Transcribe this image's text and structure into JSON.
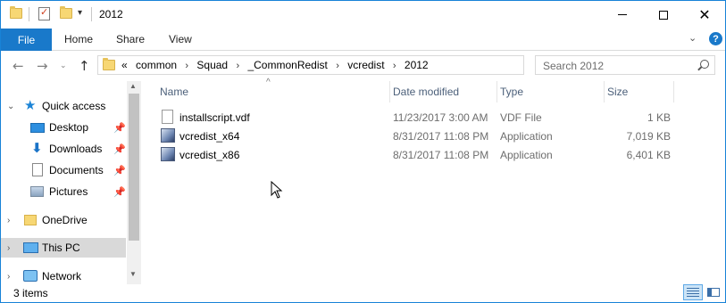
{
  "window": {
    "title": "2012"
  },
  "ribbon": {
    "tabs": [
      "File",
      "Home",
      "Share",
      "View"
    ]
  },
  "address": {
    "breadcrumbs": [
      "common",
      "Squad",
      "_CommonRedist",
      "vcredist",
      "2012"
    ],
    "overflow": "«"
  },
  "search": {
    "placeholder": "Search 2012"
  },
  "navpane": {
    "items": [
      {
        "label": "Quick access",
        "icon": "star-icon"
      },
      {
        "label": "Desktop",
        "icon": "desktop-icon",
        "pinned": true
      },
      {
        "label": "Downloads",
        "icon": "downloads-icon",
        "pinned": true
      },
      {
        "label": "Documents",
        "icon": "documents-icon",
        "pinned": true
      },
      {
        "label": "Pictures",
        "icon": "pictures-icon",
        "pinned": true
      },
      {
        "label": "OneDrive",
        "icon": "onedrive-folder-icon"
      },
      {
        "label": "This PC",
        "icon": "computer-icon",
        "selected": true
      },
      {
        "label": "Network",
        "icon": "network-icon"
      }
    ]
  },
  "filelist": {
    "columns": [
      "Name",
      "Date modified",
      "Type",
      "Size"
    ],
    "rows": [
      {
        "name": "installscript.vdf",
        "date": "11/23/2017 3:00 AM",
        "type": "VDF File",
        "size": "1 KB",
        "icon": "file-icon"
      },
      {
        "name": "vcredist_x64",
        "date": "8/31/2017 11:08 PM",
        "type": "Application",
        "size": "7,019 KB",
        "icon": "installer-icon"
      },
      {
        "name": "vcredist_x86",
        "date": "8/31/2017 11:08 PM",
        "type": "Application",
        "size": "6,401 KB",
        "icon": "installer-icon"
      }
    ]
  },
  "status": {
    "text": "3 items"
  },
  "colors": {
    "accent": "#1979ca",
    "selected": "#d9d9d9",
    "header_text": "#4c607a"
  }
}
